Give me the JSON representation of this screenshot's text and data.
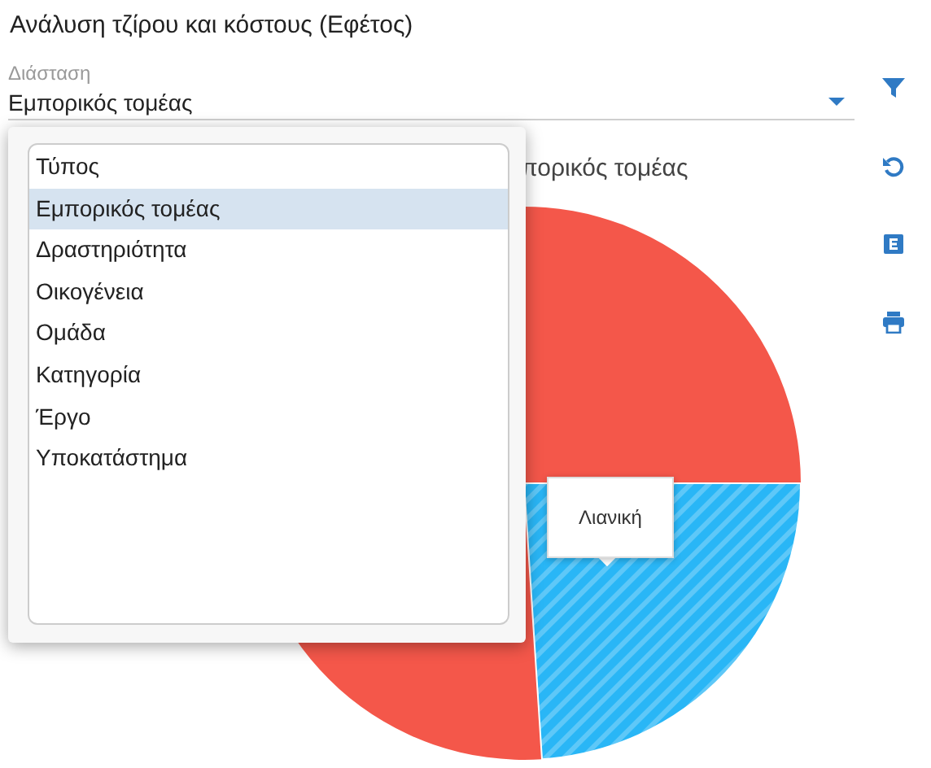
{
  "title": "Ανάλυση τζίρου και κόστους (Εφέτος)",
  "dimension_field": {
    "label": "Διάσταση",
    "value": "Εμπορικός τομέας"
  },
  "dropdown": {
    "options": [
      {
        "label": "Τύπος",
        "selected": false
      },
      {
        "label": "Εμπορικός τομέας",
        "selected": true
      },
      {
        "label": "Δραστηριότητα",
        "selected": false
      },
      {
        "label": "Οικογένεια",
        "selected": false
      },
      {
        "label": "Ομάδα",
        "selected": false
      },
      {
        "label": "Κατηγορία",
        "selected": false
      },
      {
        "label": "Έργο",
        "selected": false
      },
      {
        "label": "Υποκατάστημα",
        "selected": false
      }
    ]
  },
  "chart": {
    "title": "πορικός τομέας",
    "tooltip": "Λιανική"
  }
}
